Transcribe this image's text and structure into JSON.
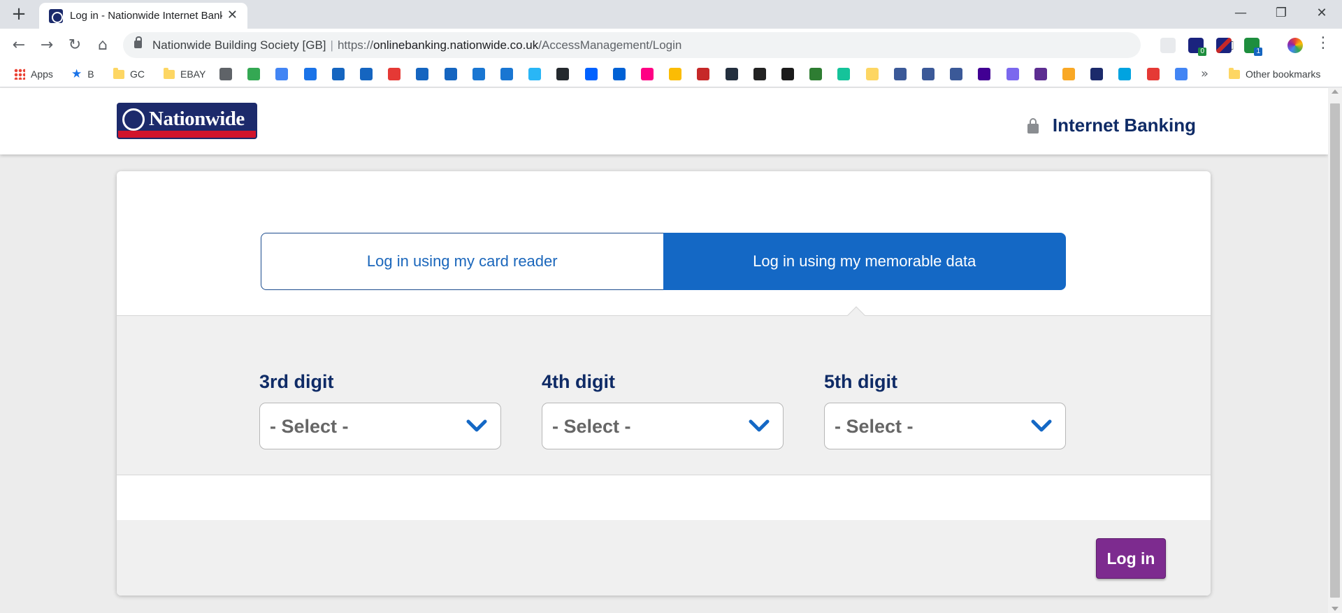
{
  "browser": {
    "tab_title": "Log in - Nationwide Internet Banking",
    "tab_close": "✕",
    "new_tab": "+",
    "window_controls": {
      "minimize": "—",
      "restore": "❐",
      "close": "✕"
    },
    "nav": {
      "back": "←",
      "forward": "→",
      "reload": "↻",
      "home": "⌂"
    },
    "omnibox": {
      "org": "Nationwide Building Society [GB]",
      "separator": "|",
      "scheme": "https://",
      "host": "onlinebanking.nationwide.co.uk",
      "path": "/AccessManagement/Login"
    },
    "key_icon": "⚿",
    "star_icon": "★",
    "menu_icon": "⋮",
    "extensions": [
      {
        "name": "extension-1-icon",
        "color": "#5f6368"
      },
      {
        "name": "extension-flag-icon",
        "color": "#c62828",
        "badge": "0"
      },
      {
        "name": "uk-flag-icon",
        "color": "#1a237e"
      },
      {
        "name": "extension-s-icon",
        "color": "#1e8e3e",
        "badge": "1"
      },
      {
        "name": "chrome-profile-icon",
        "color": "#8e24aa"
      }
    ],
    "bookmarks": {
      "apps": "Apps",
      "b": "B",
      "gc": "GC",
      "ebay": "EBAY",
      "more": "»",
      "other": "Other bookmarks",
      "favicons": [
        "#5f6368",
        "#34a853",
        "#4285f4",
        "#1a73e8",
        "#1565c0",
        "#1565c0",
        "#e53935",
        "#1565c0",
        "#1565c0",
        "#1976d2",
        "#1976d2",
        "#29b6f6",
        "#24292e",
        "#0061ff",
        "#0061d5",
        "#ff0084",
        "#fbbc04",
        "#c62828",
        "#232f3e",
        "#222222",
        "#1b1b1b",
        "#2e7d32",
        "#15c39a",
        "#fdd663",
        "#3b5998",
        "#3b5998",
        "#3b5998",
        "#410093",
        "#7b68ee",
        "#5c2d91",
        "#f9a825",
        "#1b2a6b",
        "#00a3e0",
        "#e53935",
        "#4285f4"
      ]
    }
  },
  "site": {
    "logo_text": "Nationwide",
    "header_title": "Internet Banking"
  },
  "login": {
    "card_reader_tab": "Log in using my card reader",
    "memorable_data_tab": "Log in using my memorable data",
    "digits": [
      {
        "label": "3rd digit",
        "value": "- Select -"
      },
      {
        "label": "4th digit",
        "value": "- Select -"
      },
      {
        "label": "5th digit",
        "value": "- Select -"
      }
    ],
    "login_button": "Log in"
  },
  "colors": {
    "brand_navy": "#0f2b66",
    "brand_blue": "#1468c5",
    "login_purple": "#7d2b8f",
    "logo_red": "#d1142c"
  }
}
